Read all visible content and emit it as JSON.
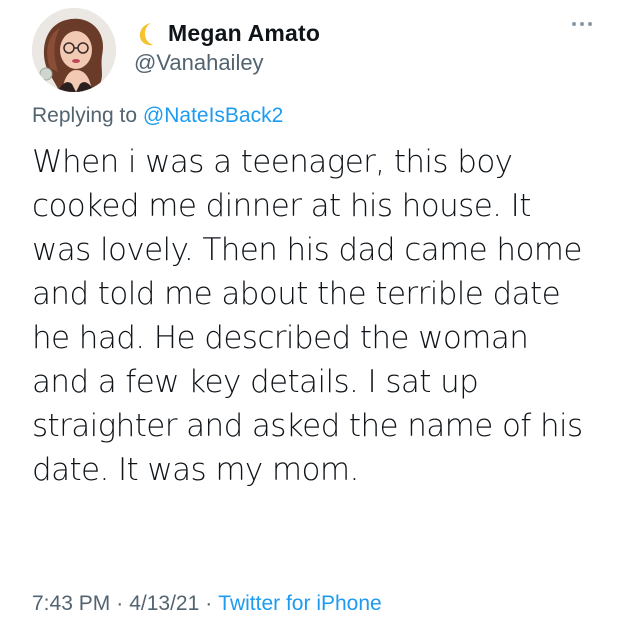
{
  "user": {
    "display_name": "Megan Amato",
    "handle": "@Vanahailey",
    "name_emoji": "crescent-moon-icon",
    "avatar": "avatar-illustration"
  },
  "reply": {
    "prefix": "Replying to",
    "mention": "@NateIsBack2"
  },
  "tweet": {
    "text": "When i was a teenager, this boy\ncooked me dinner at his house. It\nwas lovely. Then his dad came home\nand told me about the terrible date\nhe had. He described the woman\nand a few key details. I sat up\nstraighter and asked the name of his\ndate. It was my mom."
  },
  "meta": {
    "time": "7:43 PM",
    "date": "4/13/21",
    "separator": "·",
    "source": "Twitter for iPhone"
  },
  "colors": {
    "text": "#0f1419",
    "secondary": "#536471",
    "link": "#1d9bf0",
    "moon": "#f4c430"
  }
}
